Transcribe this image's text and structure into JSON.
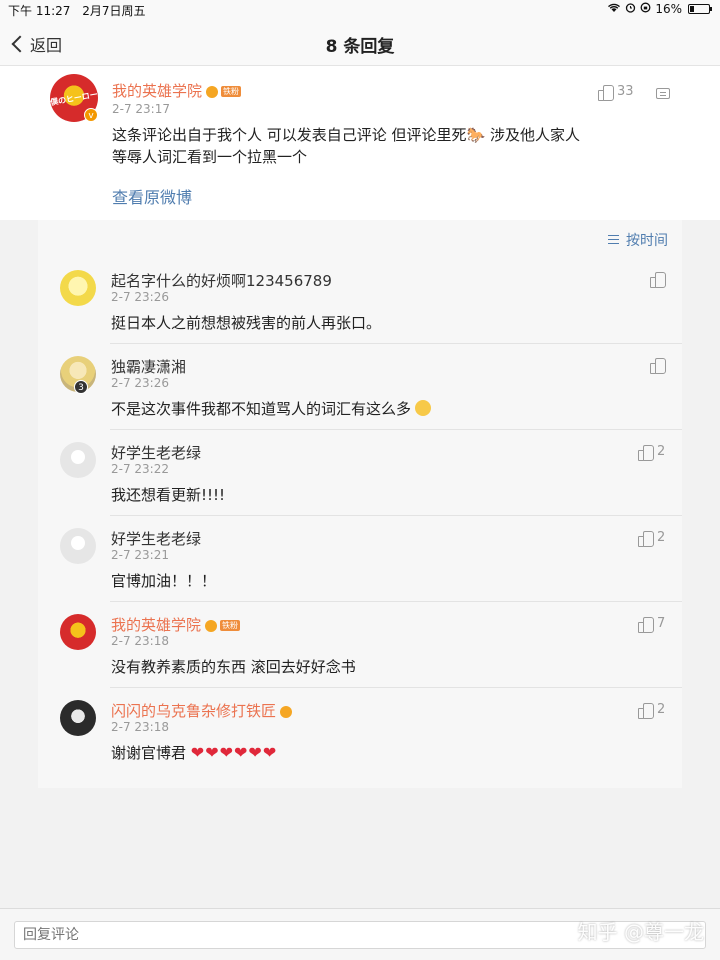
{
  "status_bar": {
    "time": "下午 11:27",
    "date": "2月7日周五",
    "battery": "16%"
  },
  "nav": {
    "back_label": "返回",
    "title": "8 条回复"
  },
  "main_comment": {
    "username": "我的英雄学院",
    "fan_badge": "铁粉",
    "time": "2-7 23:17",
    "text_line1": "这条评论出自于我个人 可以发表自己评论 但评论里死🐎 涉及他人家人",
    "text_line2": "等辱人词汇看到一个拉黑一个",
    "likes": "33",
    "view_original": "查看原微博",
    "avatar_text": "僕のヒーロー"
  },
  "sort_label": "按时间",
  "replies": [
    {
      "username": "起名字什么的好烦啊123456789",
      "time": "2-7 23:26",
      "text": "挺日本人之前想想被残害的前人再张口。",
      "likes": ""
    },
    {
      "username": "独霸凄潇湘",
      "time": "2-7 23:26",
      "text": "不是这次事件我都不知道骂人的词汇有这么多",
      "likes": "",
      "avatar_badge": "3"
    },
    {
      "username": "好学生老老绿",
      "time": "2-7 23:22",
      "text": "我还想看更新!!!!",
      "likes": "2"
    },
    {
      "username": "好学生老老绿",
      "time": "2-7 23:21",
      "text": "官博加油！！！",
      "likes": "2"
    },
    {
      "username": "我的英雄学院",
      "time": "2-7 23:18",
      "text": "没有教养素质的东西 滚回去好好念书",
      "likes": "7",
      "fan_badge": "铁粉"
    },
    {
      "username": "闪闪的乌克鲁杂修打铁匠",
      "time": "2-7 23:18",
      "text": "谢谢官博君",
      "hearts": "❤❤❤❤❤❤",
      "likes": "2"
    }
  ],
  "input": {
    "placeholder": "回复评论"
  },
  "watermark": "知乎 @尊一龙",
  "colors": {
    "accent_link": "#507daf",
    "username_orange": "#eb7350",
    "heart": "#e0283a"
  }
}
